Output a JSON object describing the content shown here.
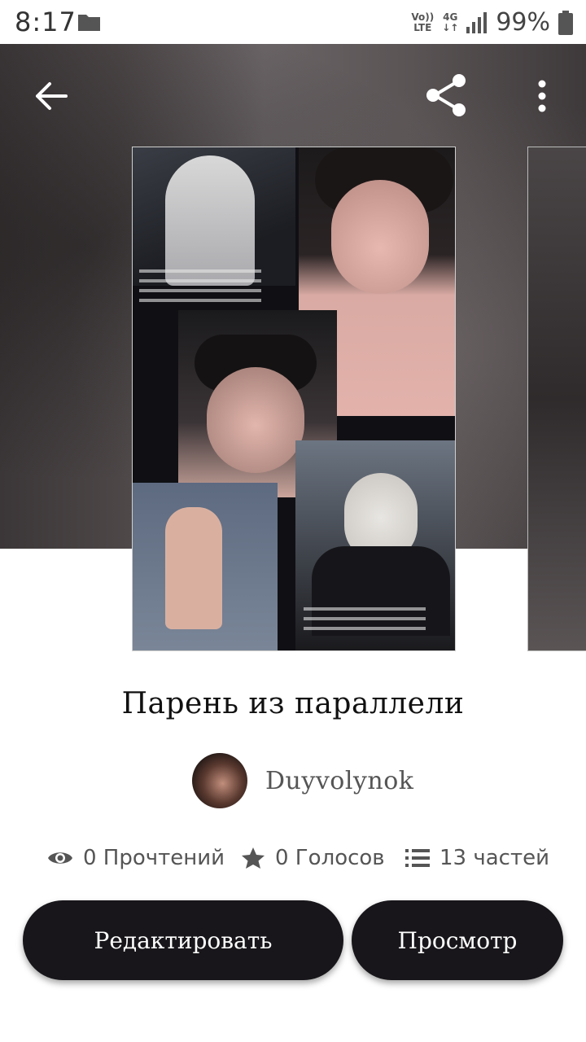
{
  "status_bar": {
    "time": "8:17",
    "volte_top": "Vo))",
    "volte_bottom": "LTE",
    "net_top": "4G",
    "net_bottom": "↓↑",
    "battery_pct": "99%"
  },
  "toolbar": {
    "back_icon": "arrow-left-icon",
    "share_icon": "share-icon",
    "more_icon": "more-vertical-icon"
  },
  "story": {
    "title": "Парень из параллели",
    "author": "Duyvolynok",
    "stats": {
      "views": "0 Прочтений",
      "votes": "0 Голосов",
      "parts": "13 частей"
    }
  },
  "actions": {
    "edit_label": "Редактировать",
    "view_label": "Просмотр"
  },
  "colors": {
    "button_bg": "#18161a",
    "text_muted": "#555555"
  }
}
